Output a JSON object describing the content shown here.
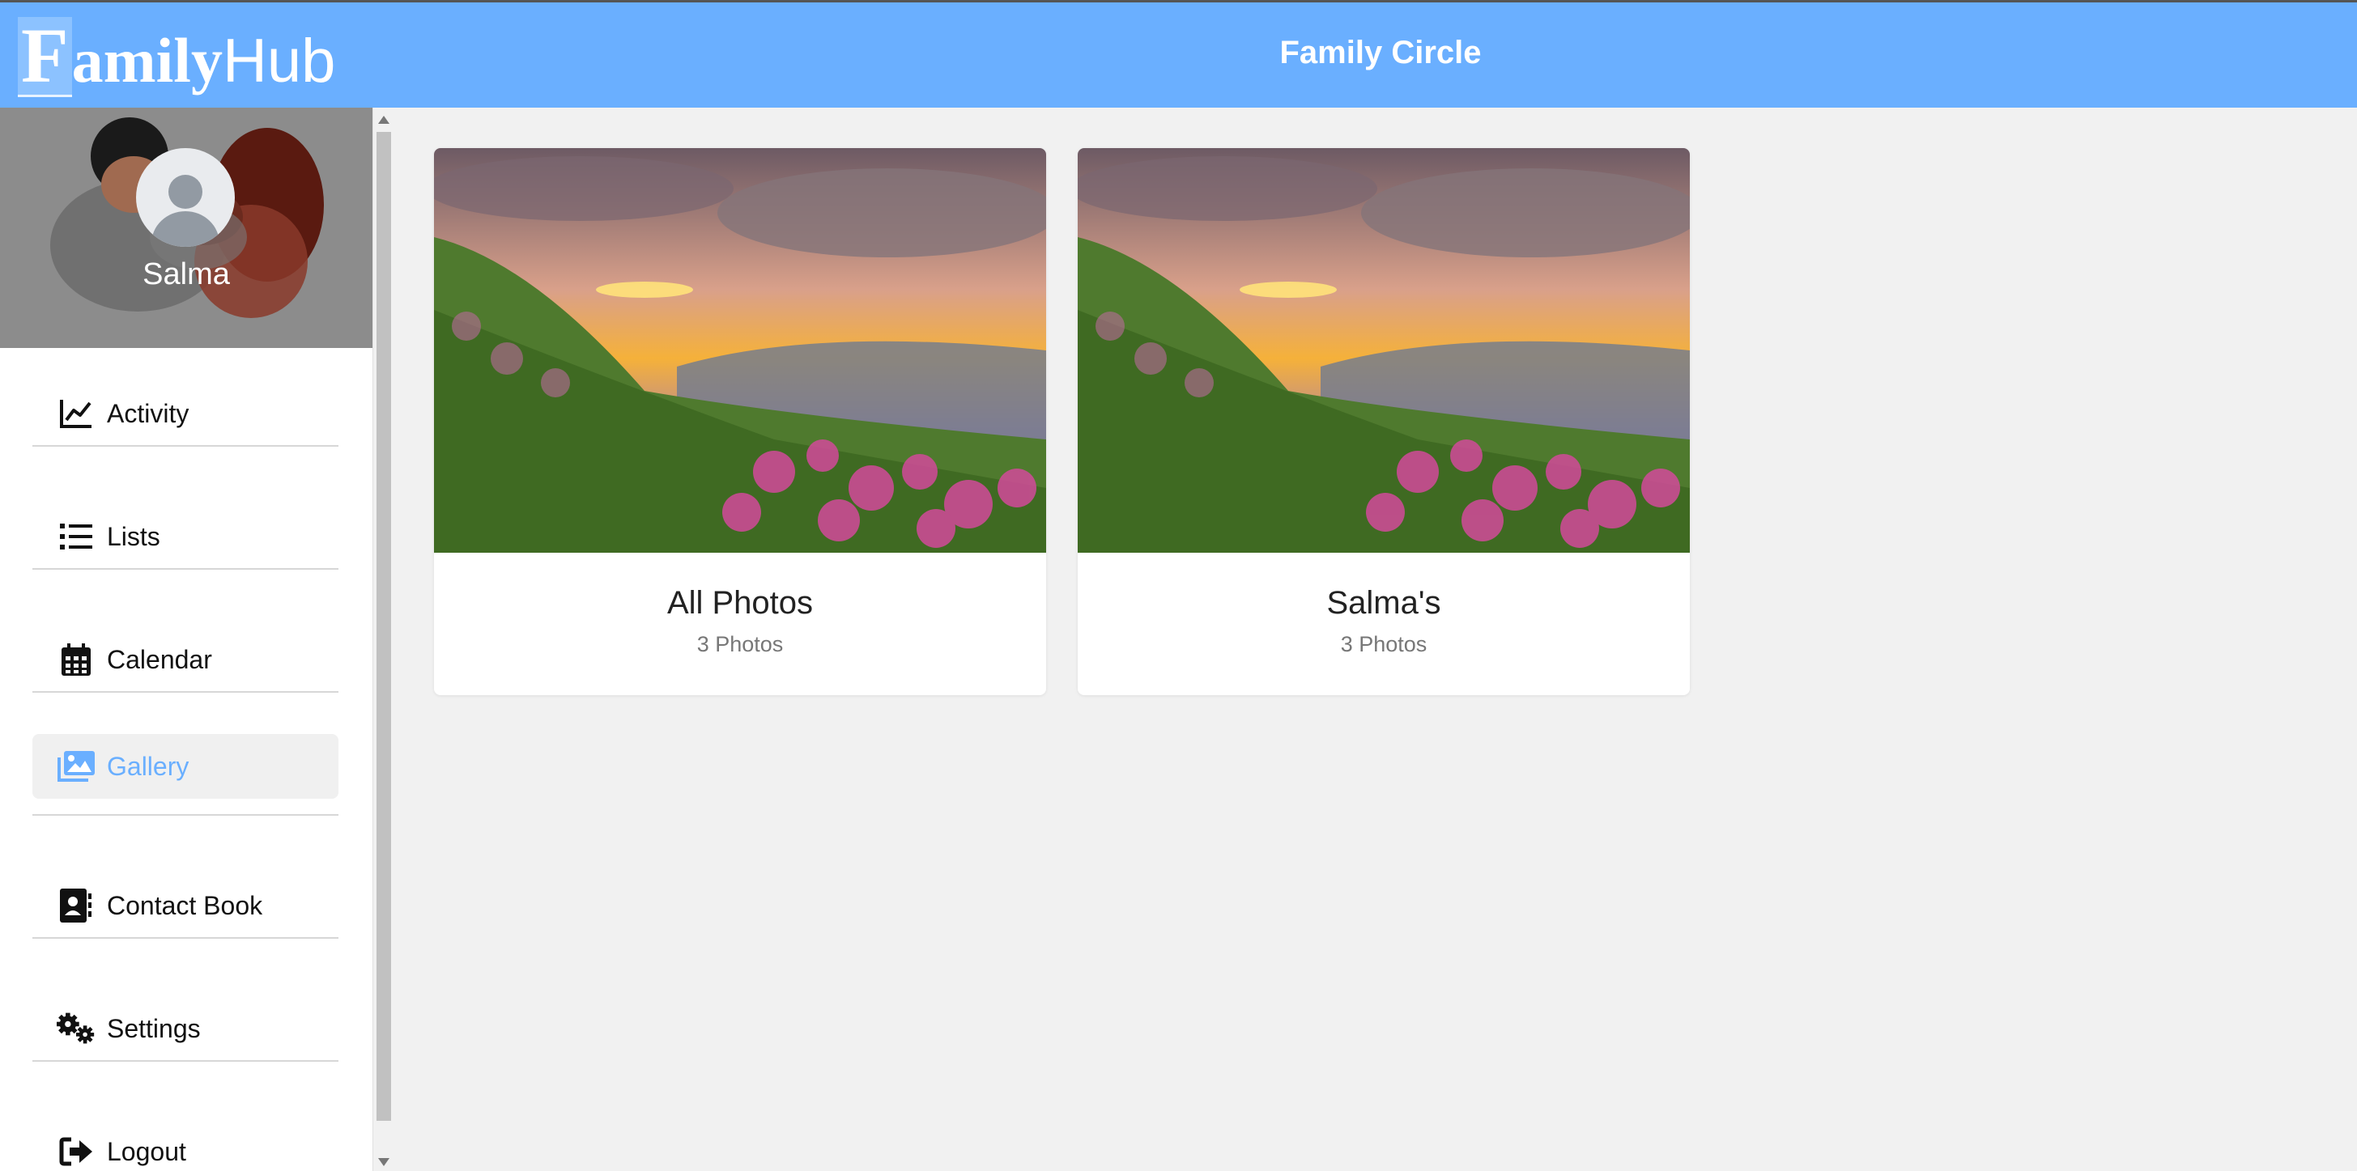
{
  "header": {
    "logo_first_letter": "F",
    "logo_rest_bold": "amily",
    "logo_rest_light": "Hub",
    "title": "Family Circle"
  },
  "sidebar": {
    "profile_name": "Salma",
    "items": [
      {
        "label": "Activity",
        "icon": "chart-line-icon",
        "active": false
      },
      {
        "label": "Lists",
        "icon": "list-icon",
        "active": false
      },
      {
        "label": "Calendar",
        "icon": "calendar-icon",
        "active": false
      },
      {
        "label": "Gallery",
        "icon": "images-icon",
        "active": true
      },
      {
        "label": "Contact Book",
        "icon": "address-book-icon",
        "active": false
      },
      {
        "label": "Settings",
        "icon": "gears-icon",
        "active": false
      },
      {
        "label": "Logout",
        "icon": "sign-out-icon",
        "active": false
      }
    ]
  },
  "gallery": {
    "albums": [
      {
        "title": "All Photos",
        "count": "3 Photos"
      },
      {
        "title": "Salma's",
        "count": "3 Photos"
      }
    ]
  },
  "colors": {
    "brand": "#6aafff",
    "background": "#f1f1f1",
    "active_item_bg": "#f0f0f0"
  }
}
